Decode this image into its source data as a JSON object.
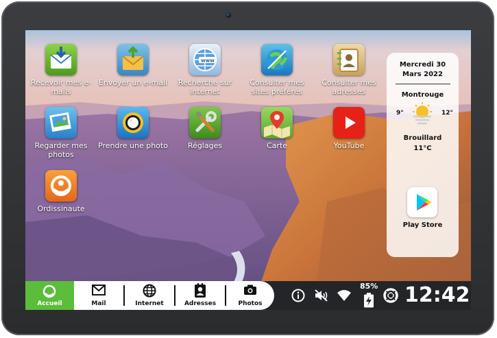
{
  "desktop": {
    "apps": [
      {
        "label": "Recevoir mes e-mails",
        "icon": "receive-email-icon"
      },
      {
        "label": "Envoyer un e-mail",
        "icon": "send-email-icon"
      },
      {
        "label": "Recherche sur internet",
        "icon": "web-search-icon"
      },
      {
        "label": "Consulter mes sites préférés",
        "icon": "favorite-sites-icon"
      },
      {
        "label": "Consulter mes adresses",
        "icon": "address-book-icon"
      },
      {
        "label": "Regarder mes photos",
        "icon": "photos-icon"
      },
      {
        "label": "Prendre une photo",
        "icon": "camera-lens-icon"
      },
      {
        "label": "Réglages",
        "icon": "settings-tools-icon"
      },
      {
        "label": "Carte",
        "icon": "map-pin-icon"
      },
      {
        "label": "YouTube",
        "icon": "youtube-icon"
      },
      {
        "label": "Ordissinaute",
        "icon": "ordissinaute-logo-icon"
      }
    ]
  },
  "weather": {
    "date": "Mercredi 30",
    "date2": "Mars 2022",
    "city": "Montrouge",
    "min": "9°",
    "max": "12°",
    "condition": "Brouillard",
    "temp": "11°C",
    "icon": "sun-fog-icon",
    "store_label": "Play Store"
  },
  "taskbar": {
    "home": "Accueil",
    "mail": "Mail",
    "internet": "Internet",
    "contacts": "Adresses",
    "photos": "Photos",
    "battery": "85%",
    "clock": "12:42"
  },
  "colors": {
    "home_active": "#5bbd3a",
    "taskbar_bg": "#232528",
    "youtube_red": "#e62117"
  }
}
